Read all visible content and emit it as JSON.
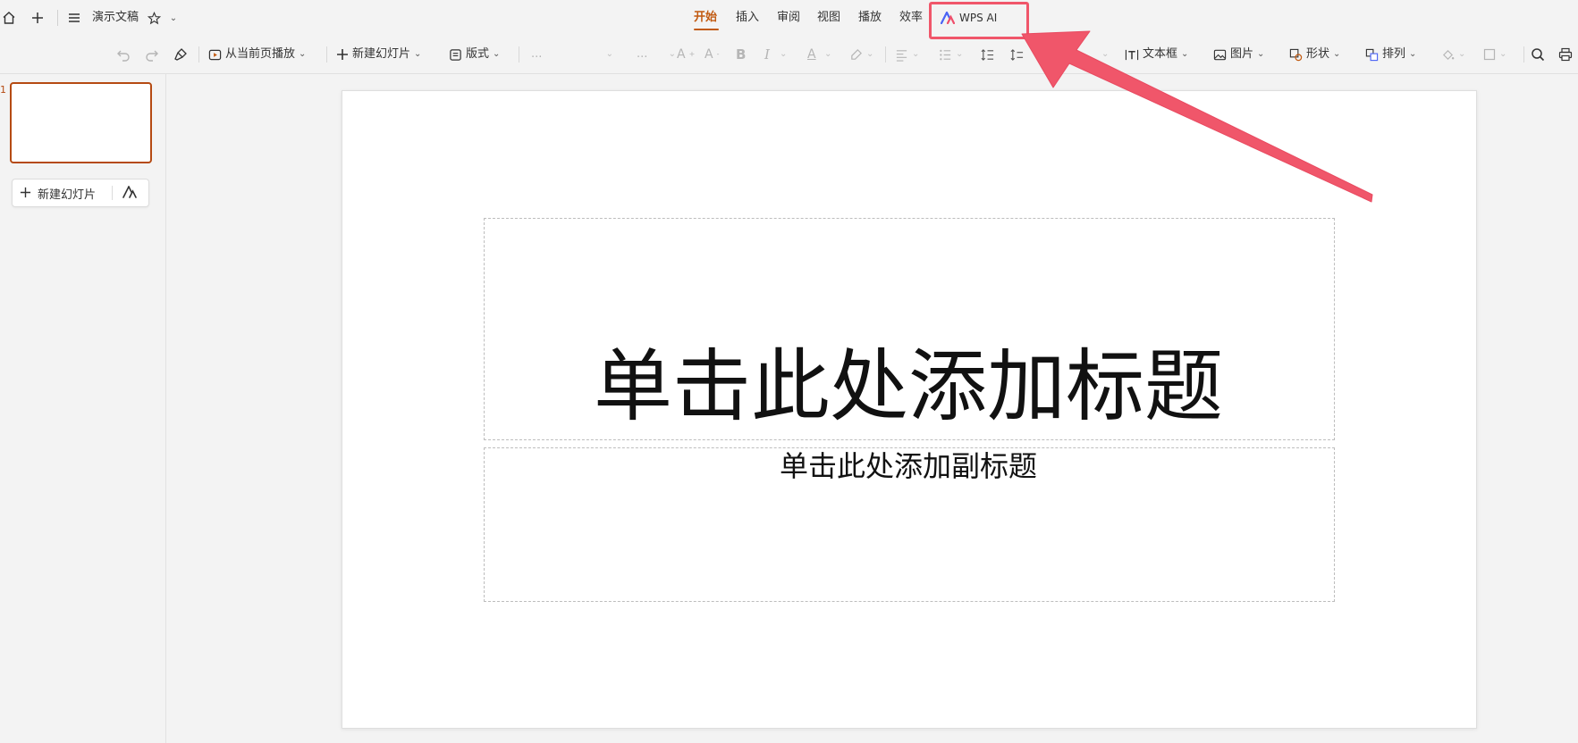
{
  "titlebar": {
    "doc_name": "演示文稿",
    "tabs": [
      {
        "label": "开始",
        "active": true
      },
      {
        "label": "插入"
      },
      {
        "label": "审阅"
      },
      {
        "label": "视图"
      },
      {
        "label": "播放"
      },
      {
        "label": "效率"
      }
    ],
    "ai_tab": "WPS AI"
  },
  "toolbar": {
    "play_from_current": "从当前页播放",
    "new_slide": "新建幻灯片",
    "layout": "版式",
    "font_placeholder": "...",
    "size_placeholder": "...",
    "bold": "B",
    "italic": "I",
    "font_color": "A",
    "textbox": "文本框",
    "picture": "图片",
    "shape": "形状",
    "arrange": "排列"
  },
  "sidebar": {
    "slide_number": "1",
    "new_slide_button": "新建幻灯片"
  },
  "slide": {
    "title_placeholder": "单击此处添加标题",
    "subtitle_placeholder": "单击此处添加副标题"
  },
  "colors": {
    "accent": "#c15a11",
    "annotation": "#f0566a"
  }
}
